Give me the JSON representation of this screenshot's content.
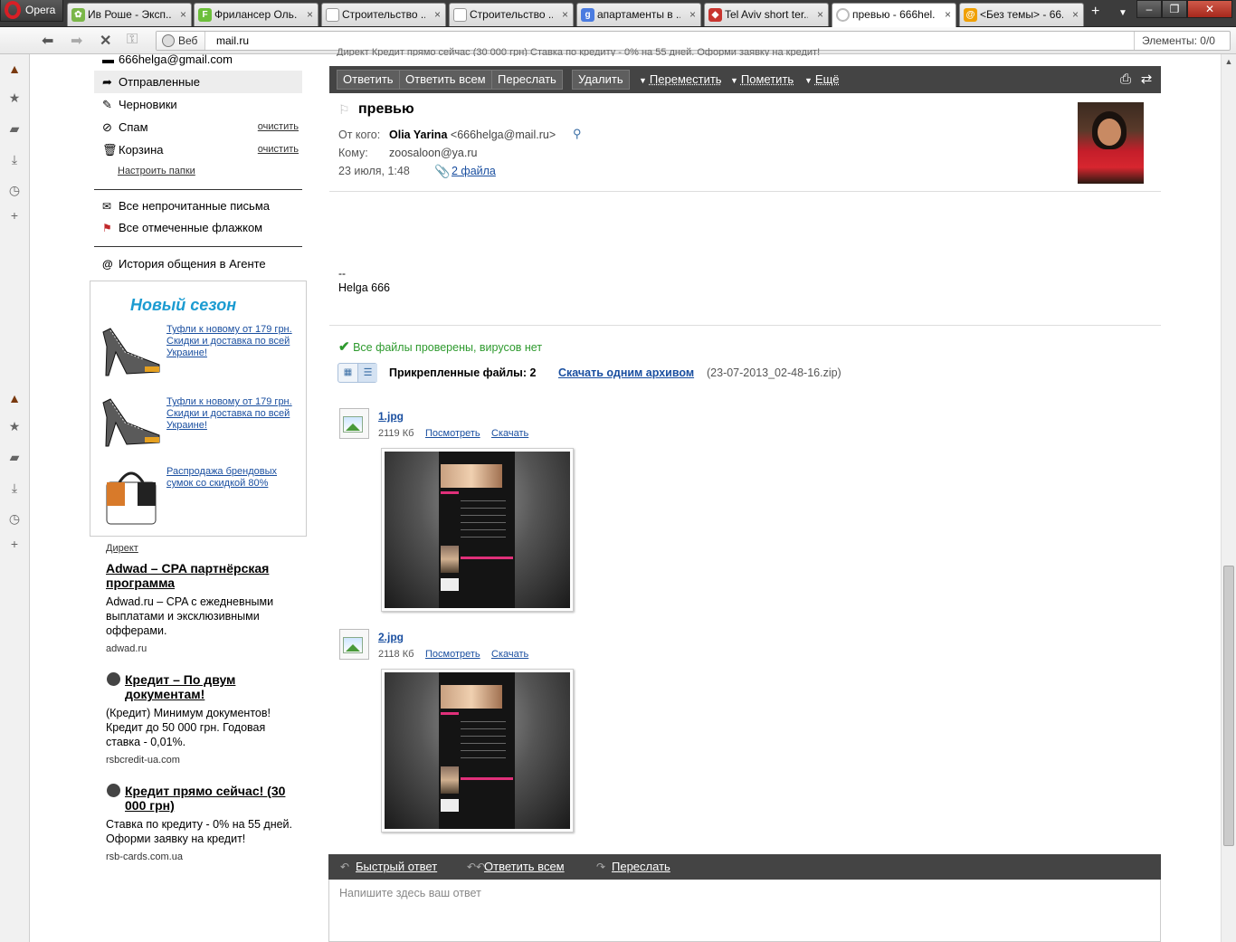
{
  "browser": {
    "menu_label": "Opera",
    "tabs": [
      {
        "label": "Ив Роше - Эксп...",
        "icon": "yves-rocher-icon",
        "color": "#7ab648"
      },
      {
        "label": "Фрилансер Оль...",
        "icon": "freelancer-icon",
        "color": "#6cbf3a"
      },
      {
        "label": "Строительство ...",
        "icon": "page-icon",
        "color": "#bbbbbb"
      },
      {
        "label": "Строительство ...",
        "icon": "page-icon",
        "color": "#bbbbbb"
      },
      {
        "label": "апартаменты в ...",
        "icon": "google-icon",
        "color": "#4a7be0"
      },
      {
        "label": "Tel Aviv short ter...",
        "icon": "site-icon",
        "color": "#c8352f"
      },
      {
        "label": "превью - 666hel...",
        "icon": "loading-icon",
        "color": "#ffffff"
      },
      {
        "label": "<Без темы> - 66...",
        "icon": "mailru-icon",
        "color": "#f0a000"
      }
    ],
    "address": {
      "badge": "Веб",
      "url": "mail.ru",
      "elements_label": "Элементы:",
      "elements_value": "0/0"
    }
  },
  "folders": {
    "account": "666helga@gmail.com",
    "items": [
      {
        "label": "Отправленные",
        "icon": "sent-arrow-icon"
      },
      {
        "label": "Черновики",
        "icon": "draft-icon"
      },
      {
        "label": "Спам",
        "icon": "spam-icon",
        "action": "очистить"
      },
      {
        "label": "Корзина",
        "icon": "trash-icon",
        "action": "очистить"
      }
    ],
    "setup": "Настроить папки",
    "unread": "Все непрочитанные письма",
    "flagged": "Все отмеченные флажком",
    "agent": "История общения в Агенте"
  },
  "promo": {
    "title": "Новый сезон",
    "items": [
      "Туфли к новому от 179 грн. Скидки и доставка по всей Украине!",
      "Туфли к новому от 179 грн. Скидки и доставка по всей Украине!",
      "Распродажа брендовых сумок со скидкой 80%"
    ]
  },
  "direct": {
    "label": "Директ",
    "ads": [
      {
        "title": "Adwad – CPA партнёрская программа",
        "text": "Adwad.ru – CPA с ежедневными выплатами и эксклюзивными офферами.",
        "url": "adwad.ru"
      },
      {
        "title": "Кредит – По двум документам!",
        "text": "(Кредит) Минимум документов! Кредит до 50 000 грн. Годовая ставка - 0,01%.",
        "url": "rsbcredit-ua.com"
      },
      {
        "title": "Кредит прямо сейчас! (30 000 грн)",
        "text": "Ставка по кредиту - 0% на 55 дней. Оформи заявку на кредит!",
        "url": "rsb-cards.com.ua"
      }
    ]
  },
  "top_cut_text": "Директ   Кредит прямо сейчас (30 000 грн)  Ставка по кредиту - 0% на 55 дней. Оформи заявку на кредит!",
  "toolbar": {
    "reply": "Ответить",
    "reply_all": "Ответить всем",
    "forward": "Переслать",
    "delete": "Удалить",
    "move": "Переместить",
    "mark": "Пометить",
    "more": "Ещё"
  },
  "message": {
    "subject": "превью",
    "from_label": "От кого:",
    "from_name": "Olia Yarina",
    "from_email": "<666helga@mail.ru>",
    "to_label": "Кому:",
    "to": "zoosaloon@ya.ru",
    "date": "23 июля, 1:48",
    "files_link": "2 файла",
    "sig_dash": "--",
    "sig_name": "Helga 666"
  },
  "attachments": {
    "virus_check": "Все файлы проверены, вирусов нет",
    "count_label": "Прикрепленные файлы: 2",
    "download_all": "Скачать одним архивом",
    "zip_name": "(23-07-2013_02-48-16.zip)",
    "files": [
      {
        "name": "1.jpg",
        "size": "2119 Кб",
        "view": "Посмотреть",
        "download": "Скачать"
      },
      {
        "name": "2.jpg",
        "size": "2118 Кб",
        "view": "Посмотреть",
        "download": "Скачать"
      }
    ]
  },
  "reply_bar": {
    "quick_reply": "Быстрый ответ",
    "reply_all": "Ответить всем",
    "forward": "Переслать",
    "placeholder": "Напишите здесь ваш ответ"
  }
}
